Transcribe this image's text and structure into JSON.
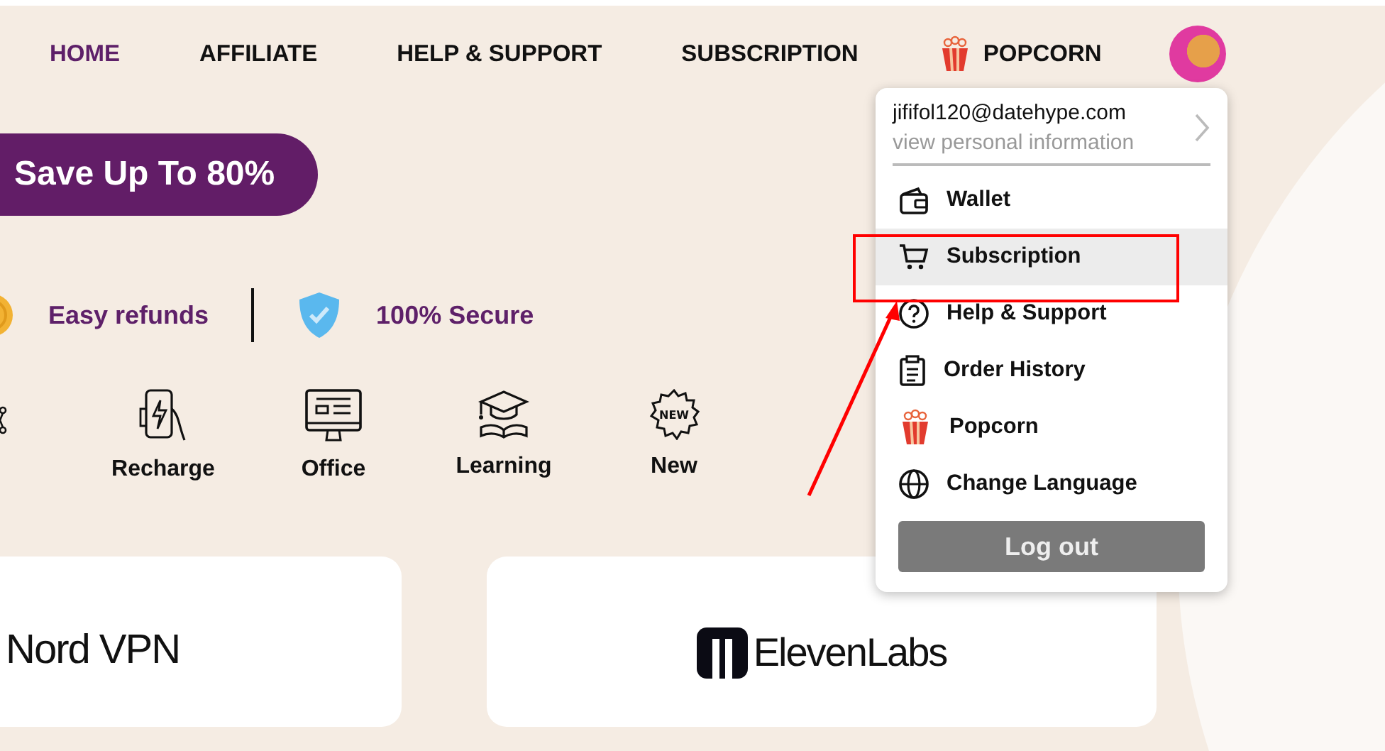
{
  "nav": [
    {
      "label": "HOME",
      "selected": true,
      "kind": "text"
    },
    {
      "label": "AFFILIATE",
      "selected": false,
      "kind": "text"
    },
    {
      "label": "HELP & SUPPORT",
      "selected": false,
      "kind": "text"
    },
    {
      "label": "SUBSCRIPTION",
      "selected": false,
      "kind": "text"
    },
    {
      "label": "POPCORN",
      "selected": false,
      "kind": "popcorn"
    }
  ],
  "banner": {
    "text": "Save Up To 80%"
  },
  "features": [
    {
      "label": "Easy refunds",
      "kind": "coin"
    },
    {
      "label": "100% Secure",
      "kind": "shield"
    }
  ],
  "categories": [
    {
      "label": "Recharge",
      "kind": "recharge"
    },
    {
      "label": "Office",
      "kind": "office"
    },
    {
      "label": "Learning",
      "kind": "learning"
    },
    {
      "label": "New",
      "kind": "new",
      "badge": "NEW"
    }
  ],
  "cards": [
    {
      "title": "Nord VPN",
      "kind": "text"
    },
    {
      "title": "ElevenLabs",
      "kind": "logo"
    }
  ],
  "account_menu": {
    "email": "jififol120@datehype.com",
    "subtitle": "view personal information",
    "items": [
      {
        "label": "Wallet",
        "kind": "wallet",
        "selected": false
      },
      {
        "label": "Subscription",
        "kind": "cart",
        "selected": true
      },
      {
        "label": "Help & Support",
        "kind": "help",
        "selected": false
      },
      {
        "label": "Order History",
        "kind": "clipboard",
        "selected": false
      },
      {
        "label": "Popcorn",
        "kind": "popcorn",
        "selected": false
      },
      {
        "label": "Change Language",
        "kind": "globe",
        "selected": false
      }
    ],
    "logout": "Log out"
  }
}
